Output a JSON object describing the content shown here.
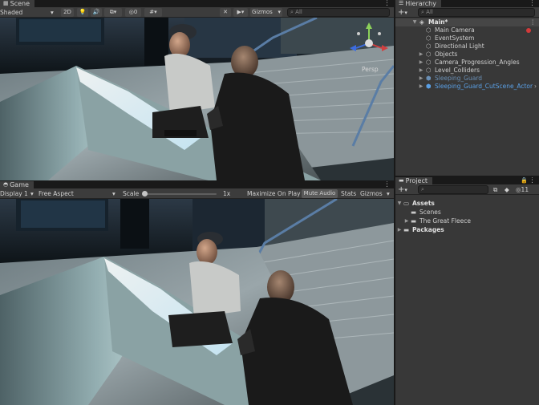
{
  "scene": {
    "tab_label": "Scene",
    "draw_mode": "Shaded",
    "mode_2d": "2D",
    "hidden_count": "0",
    "gizmos_label": "Gizmos",
    "search_placeholder": "All",
    "view_label": "Persp"
  },
  "game": {
    "tab_label": "Game",
    "display": "Display 1",
    "aspect": "Free Aspect",
    "scale_label": "Scale",
    "scale_value": "1x",
    "maximize_on_play": "Maximize On Play",
    "mute_audio": "Mute Audio",
    "stats": "Stats",
    "gizmos_label": "Gizmos"
  },
  "hierarchy": {
    "tab_label": "Hierarchy",
    "add_label": "+",
    "search_placeholder": "All",
    "scene_name": "Main*",
    "items": [
      {
        "label": "Main Camera"
      },
      {
        "label": "EventSystem"
      },
      {
        "label": "Directional Light"
      },
      {
        "label": "Objects"
      },
      {
        "label": "Camera_Progression_Angles"
      },
      {
        "label": "Level_Colliders"
      },
      {
        "label": "Sleeping_Guard"
      },
      {
        "label": "Sleeping_Guard_CutScene_Actor"
      }
    ]
  },
  "project": {
    "tab_label": "Project",
    "add_label": "+",
    "hidden_count": "11",
    "assets_label": "Assets",
    "folders": [
      {
        "label": "Scenes"
      },
      {
        "label": "The Great Fleece"
      }
    ],
    "packages_label": "Packages"
  },
  "colors": {
    "accent_blue": "#4d8cd9",
    "prefab_blue": "#5aa0e6",
    "disabled_prefab": "#6a8fb5",
    "panel": "#282828",
    "toolbar": "#3c3c3c"
  }
}
